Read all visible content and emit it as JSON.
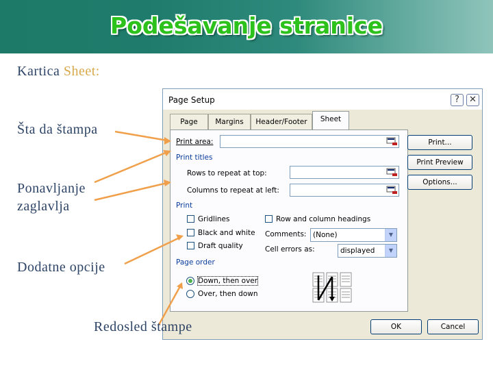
{
  "slide": {
    "title": "Podešavanje stranice",
    "subtitle_prefix": "Kartica ",
    "subtitle_highlight": "Sheet",
    "subtitle_suffix": ":",
    "label_print_area": "Šta da štampa",
    "label_titles_1": "Ponavljanje",
    "label_titles_2": "zaglavlja",
    "label_options": "Dodatne opcije",
    "label_order": "Redosled štampe"
  },
  "dialog": {
    "title": "Page Setup",
    "help": "?",
    "close": "✕",
    "tabs": [
      "Page",
      "Margins",
      "Header/Footer",
      "Sheet"
    ],
    "print_area_label": "Print area:",
    "print_titles_section": "Print titles",
    "rows_repeat_label": "Rows to repeat at top:",
    "cols_repeat_label": "Columns to repeat at left:",
    "print_section": "Print",
    "gridlines": "Gridlines",
    "black_white": "Black and white",
    "draft_quality": "Draft quality",
    "row_col_headings": "Row and column headings",
    "comments_label": "Comments:",
    "comments_value": "(None)",
    "cell_errors_label": "Cell errors as:",
    "cell_errors_value": "displayed",
    "page_order_section": "Page order",
    "down_then_over": "Down, then over",
    "over_then_down": "Over, then down",
    "btn_print": "Print...",
    "btn_print_preview": "Print Preview",
    "btn_options": "Options...",
    "btn_ok": "OK",
    "btn_cancel": "Cancel"
  },
  "colors": {
    "arrow": "#f0a04b",
    "title_green": "#2cc21b"
  }
}
